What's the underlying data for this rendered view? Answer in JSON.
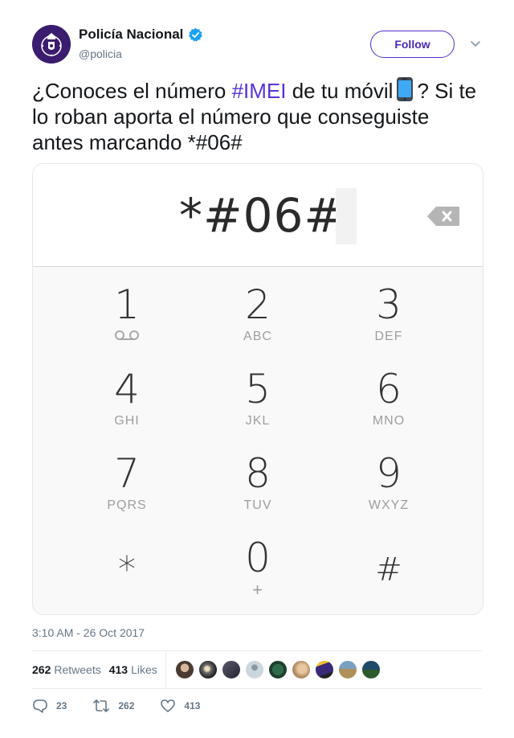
{
  "author": {
    "display_name": "Policía Nacional",
    "handle": "@policia",
    "verified": true
  },
  "follow_label": "Follow",
  "tweet": {
    "text_before": "¿Conoces el número ",
    "hashtag": "#IMEI",
    "text_mid": " de tu móvil",
    "text_after": "? Si te lo roban aporta el número que conseguiste antes marcando *#06#"
  },
  "media": {
    "dialed_number": "*#06#",
    "keypad": [
      {
        "digit": "1",
        "letters": "",
        "icon": "voicemail-icon"
      },
      {
        "digit": "2",
        "letters": "ABC"
      },
      {
        "digit": "3",
        "letters": "DEF"
      },
      {
        "digit": "4",
        "letters": "GHI"
      },
      {
        "digit": "5",
        "letters": "JKL"
      },
      {
        "digit": "6",
        "letters": "MNO"
      },
      {
        "digit": "7",
        "letters": "PQRS"
      },
      {
        "digit": "8",
        "letters": "TUV"
      },
      {
        "digit": "9",
        "letters": "WXYZ"
      },
      {
        "digit": "*",
        "letters": ""
      },
      {
        "digit": "0",
        "letters": "+"
      },
      {
        "digit": "#",
        "letters": ""
      }
    ]
  },
  "timestamp": "3:10 AM - 26 Oct 2017",
  "stats": {
    "retweets_count": "262",
    "retweets_label": "Retweets",
    "likes_count": "413",
    "likes_label": "Likes"
  },
  "actions": {
    "reply_count": "23",
    "retweet_count": "262",
    "like_count": "413"
  },
  "colors": {
    "accent": "#5a33d6",
    "verified": "#1da1f2",
    "muted": "#657786"
  }
}
